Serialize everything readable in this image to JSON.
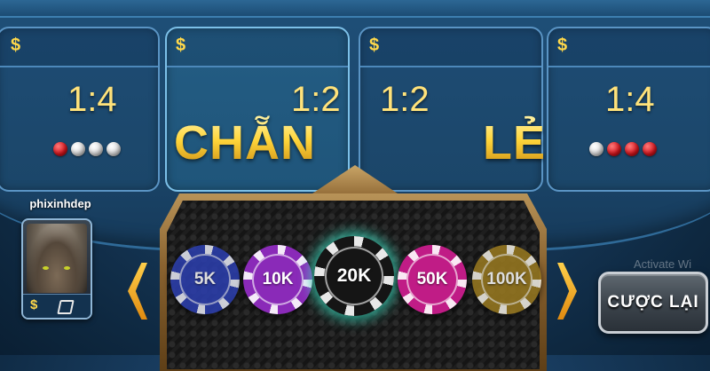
{
  "bet_boxes": [
    {
      "currency": "$",
      "ratio": "1:4",
      "balls": [
        "red",
        "white",
        "white",
        "white"
      ]
    },
    {
      "currency": "$",
      "ratio": "1:2",
      "word": "CHẴN"
    },
    {
      "currency": "$",
      "ratio": "1:2",
      "word": "LẺ"
    },
    {
      "currency": "$",
      "ratio": "1:4",
      "balls": [
        "white",
        "red",
        "red",
        "red"
      ]
    }
  ],
  "player": {
    "name": "phixinhdep",
    "currency": "$"
  },
  "chips": [
    {
      "label": "5K",
      "color": "#2c3fb0"
    },
    {
      "label": "10K",
      "color": "#8a2ab8"
    },
    {
      "label": "20K",
      "color": "#151515"
    },
    {
      "label": "50K",
      "color": "#c01c86"
    },
    {
      "label": "100K",
      "color": "#9a7a20"
    }
  ],
  "selected_chip": "20K",
  "reset_button": {
    "label": "CƯỢC LẠI"
  },
  "watermark": "Activate Wi",
  "colors": {
    "accent_gold": "#ffd84a",
    "selected_glow": "#46f0d2"
  }
}
